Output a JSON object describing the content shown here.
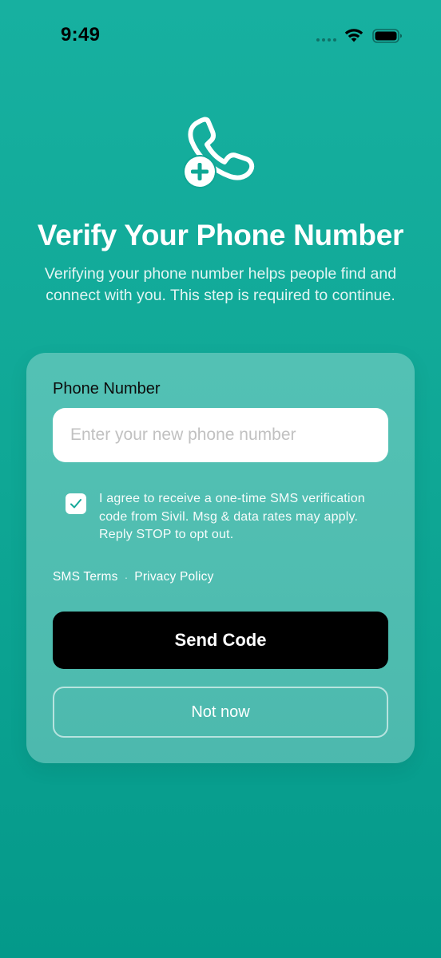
{
  "status_bar": {
    "time": "9:49",
    "icons": [
      "signal-dots-icon",
      "wifi-icon",
      "battery-icon"
    ]
  },
  "hero": {
    "icon": "phone-add-icon",
    "title": "Verify Your Phone Number",
    "subtitle": "Verifying your phone number helps people find and connect with you. This step is required to continue."
  },
  "form": {
    "phone_label": "Phone Number",
    "phone_value": "",
    "phone_placeholder": "Enter your new phone number",
    "consent_checked": true,
    "consent_text": "I agree to receive a one-time SMS verification code from Sivil. Msg & data rates may apply. Reply STOP to opt out.",
    "sms_terms_link": "SMS Terms",
    "separator": "·",
    "privacy_link": "Privacy Policy",
    "send_button": "Send Code",
    "not_now_button": "Not now"
  },
  "colors": {
    "background_top": "#17b0a0",
    "background_bottom": "#04998a",
    "accent": "#14a898",
    "primary_button": "#000000"
  }
}
